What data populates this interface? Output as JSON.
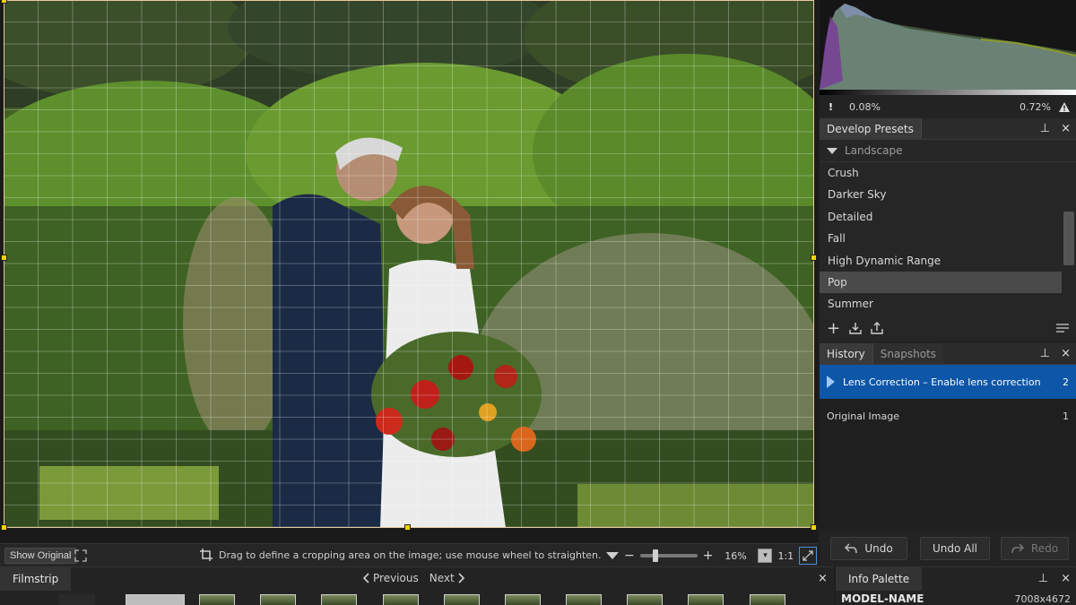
{
  "histogram": {
    "shadow_clip": "0.08%",
    "highlight_clip": "0.72%"
  },
  "presets": {
    "tab_label": "Develop Presets",
    "group": "Landscape",
    "items": [
      "Crush",
      "Darker Sky",
      "Detailed",
      "Fall",
      "High Dynamic Range",
      "Pop",
      "Summer"
    ],
    "selected": "Pop"
  },
  "history": {
    "tabs": [
      "History",
      "Snapshots"
    ],
    "rows": [
      {
        "label": "Lens Correction – Enable lens correction",
        "num": "2"
      },
      {
        "label": "Original Image",
        "num": "1"
      }
    ],
    "undo": "Undo",
    "undo_all": "Undo All",
    "redo": "Redo"
  },
  "canvas_toolbar": {
    "show_original": "Show Original",
    "hint": "Drag to define a cropping area on the image; use mouse wheel to straighten.",
    "zoom": "16%",
    "one_to_one": "1:1",
    "zoom_menu": "▾"
  },
  "filmstrip": {
    "tab_label": "Filmstrip",
    "previous": "Previous",
    "next": "Next"
  },
  "info_palette": {
    "tab_label": "Info Palette",
    "model_name": "MODEL-NAME",
    "image_size": "7008x4672"
  },
  "icons": {
    "close": "×",
    "pin": "pin-icon",
    "warning": "!"
  }
}
